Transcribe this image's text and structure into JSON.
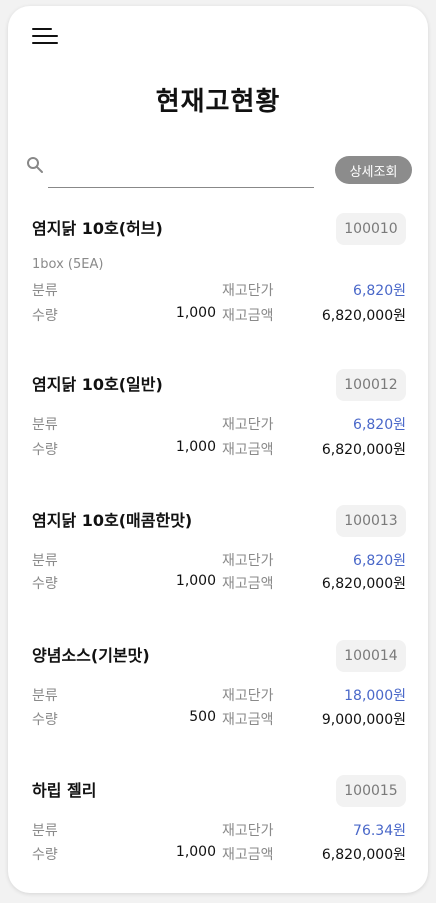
{
  "header": {
    "title": "현재고현황",
    "menu_icon": "hamburger-menu-icon"
  },
  "search": {
    "value": "",
    "placeholder": "",
    "detail_button": "상세조회",
    "icon": "search-icon"
  },
  "labels": {
    "category": "분류",
    "quantity": "수량",
    "unit_price": "재고단가",
    "amount": "재고금액"
  },
  "colors": {
    "price": "#4a68c9",
    "code_bg": "#f2f2f2",
    "detail_button_bg": "#8c8c8c"
  },
  "items": [
    {
      "name": "염지닭 10호(허브)",
      "code": "100010",
      "spec": "1box (5EA)",
      "category": "",
      "quantity": "1,000",
      "unit_price": "6,820원",
      "amount": "6,820,000원"
    },
    {
      "name": "염지닭 10호(일반)",
      "code": "100012",
      "spec": "",
      "category": "",
      "quantity": "1,000",
      "unit_price": "6,820원",
      "amount": "6,820,000원"
    },
    {
      "name": "염지닭 10호(매콤한맛)",
      "code": "100013",
      "spec": "",
      "category": "",
      "quantity": "1,000",
      "unit_price": "6,820원",
      "amount": "6,820,000원"
    },
    {
      "name": "양념소스(기본맛)",
      "code": "100014",
      "spec": "",
      "category": "",
      "quantity": "500",
      "unit_price": "18,000원",
      "amount": "9,000,000원"
    },
    {
      "name": "하립 젤리",
      "code": "100015",
      "spec": "",
      "category": "",
      "quantity": "1,000",
      "unit_price": "76.34원",
      "amount": "6,820,000원"
    }
  ]
}
